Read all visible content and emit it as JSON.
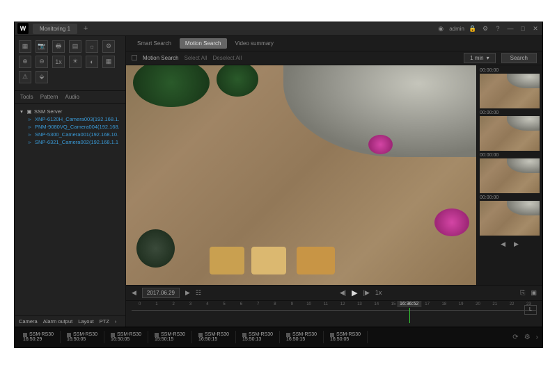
{
  "titlebar": {
    "logo": "W",
    "tab": "Monitoring 1",
    "user": "admin"
  },
  "left": {
    "subtabs": [
      "Tools",
      "Pattern",
      "Audio"
    ],
    "tree": {
      "root": "SSM Server",
      "items": [
        "XNP-6120H_Camera003(192.168.1.",
        "PNM-9080VQ_Camera004(192.168.",
        "SNP-5300_Camera001(192.168.10.",
        "SNP-6321_Camera002(192.168.1.1"
      ]
    },
    "bottom": [
      "Camera",
      "Alarm output",
      "Layout",
      "PTZ"
    ]
  },
  "center": {
    "tabs": [
      "Smart Search",
      "Motion Search",
      "Video summary"
    ],
    "active_tab": 1,
    "search": {
      "label": "Motion Search",
      "opt1": "Select All",
      "opt2": "Deselect All",
      "interval": "1 min",
      "btn": "Search"
    },
    "playback": {
      "date": "2017.06.29",
      "speed": "1x"
    },
    "timeline": {
      "cursor": "16:36:52",
      "ticks": [
        "0",
        "1",
        "2",
        "3",
        "4",
        "5",
        "6",
        "7",
        "8",
        "9",
        "10",
        "11",
        "12",
        "13",
        "14",
        "15",
        "16",
        "17",
        "18",
        "19",
        "20",
        "21",
        "22",
        "23"
      ],
      "right_btn": "L"
    }
  },
  "thumbs": {
    "times": [
      "00:00:00",
      "00:00:00",
      "00:00:00",
      "00:00:00"
    ]
  },
  "strip": {
    "items": [
      {
        "name": "SSM-RS30",
        "time": "16:50:29"
      },
      {
        "name": "SSM-RS30",
        "time": "16:50:05"
      },
      {
        "name": "SSM-RS30",
        "time": "16:50:05"
      },
      {
        "name": "SSM-RS30",
        "time": "15:50:15"
      },
      {
        "name": "SSM-RS30",
        "time": "16:50:15"
      },
      {
        "name": "SSM-RS30",
        "time": "15:50:13"
      },
      {
        "name": "SSM-RS30",
        "time": "16:50:15"
      },
      {
        "name": "SSM-RS30",
        "time": "16:50:05"
      }
    ]
  }
}
